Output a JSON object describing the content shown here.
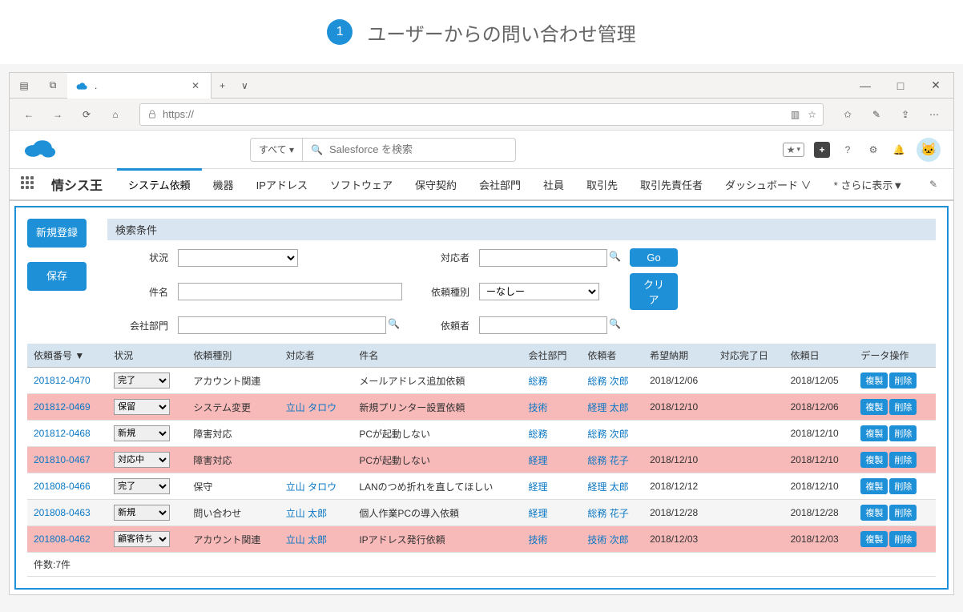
{
  "page_header": {
    "num": "1",
    "title": "ユーザーからの問い合わせ管理"
  },
  "browser": {
    "tab_title": ".",
    "url_prefix": "https://",
    "new_tab": "+",
    "minimize": "—",
    "maximize": "□",
    "close": "✕"
  },
  "sf_header": {
    "search_scope": "すべて ▾",
    "search_placeholder": "Salesforce を検索"
  },
  "nav": {
    "app_name": "情シス王",
    "tabs": [
      "システム依頼",
      "機器",
      "IPアドレス",
      "ソフトウェア",
      "保守契約",
      "会社部門",
      "社員",
      "取引先",
      "取引先責任者",
      "ダッシュボード ∨"
    ],
    "more": "* さらに表示▼"
  },
  "side": {
    "new": "新規登録",
    "save": "保存"
  },
  "filter": {
    "title": "検索条件",
    "labels": {
      "status": "状況",
      "subject": "件名",
      "dept": "会社部門",
      "assignee": "対応者",
      "kind": "依頼種別",
      "requester": "依頼者"
    },
    "kind_option": "ーなしー",
    "go": "Go",
    "clear": "クリア"
  },
  "table": {
    "headers": [
      "依頼番号 ▼",
      "状況",
      "依頼種別",
      "対応者",
      "件名",
      "会社部門",
      "依頼者",
      "希望納期",
      "対応完了日",
      "依頼日",
      "データ操作"
    ],
    "rows": [
      {
        "id": "201812-0470",
        "status": "完了",
        "kind": "アカウント関連",
        "assignee": "",
        "subject": "メールアドレス追加依頼",
        "dept": "総務",
        "requester": "総務 次郎",
        "due": "2018/12/06",
        "done": "",
        "reqdate": "2018/12/05",
        "hl": false
      },
      {
        "id": "201812-0469",
        "status": "保留",
        "kind": "システム変更",
        "assignee": "立山 タロウ",
        "subject": "新規プリンター設置依頼",
        "dept": "技術",
        "requester": "経理 太郎",
        "due": "2018/12/10",
        "done": "",
        "reqdate": "2018/12/06",
        "hl": true
      },
      {
        "id": "201812-0468",
        "status": "新規",
        "kind": "障害対応",
        "assignee": "",
        "subject": "PCが起動しない",
        "dept": "総務",
        "requester": "総務 次郎",
        "due": "",
        "done": "",
        "reqdate": "2018/12/10",
        "hl": false
      },
      {
        "id": "201810-0467",
        "status": "対応中",
        "kind": "障害対応",
        "assignee": "",
        "subject": "PCが起動しない",
        "dept": "経理",
        "requester": "総務 花子",
        "due": "2018/12/10",
        "done": "",
        "reqdate": "2018/12/10",
        "hl": true
      },
      {
        "id": "201808-0466",
        "status": "完了",
        "kind": "保守",
        "assignee": "立山 タロウ",
        "subject": "LANのつめ折れを直してほしい",
        "dept": "経理",
        "requester": "経理 太郎",
        "due": "2018/12/12",
        "done": "",
        "reqdate": "2018/12/10",
        "hl": false
      },
      {
        "id": "201808-0463",
        "status": "新規",
        "kind": "問い合わせ",
        "assignee": "立山 太郎",
        "subject": "個人作業PCの導入依頼",
        "dept": "経理",
        "requester": "総務 花子",
        "due": "2018/12/28",
        "done": "",
        "reqdate": "2018/12/28",
        "hl": false
      },
      {
        "id": "201808-0462",
        "status": "顧客待ち",
        "kind": "アカウント関連",
        "assignee": "立山 太郎",
        "subject": "IPアドレス発行依頼",
        "dept": "技術",
        "requester": "技術 次郎",
        "due": "2018/12/03",
        "done": "",
        "reqdate": "2018/12/03",
        "hl": true
      }
    ],
    "status_options": [
      "新規",
      "対応中",
      "保留",
      "完了",
      "顧客待ち"
    ],
    "row_btns": {
      "copy": "複製",
      "del": "削除"
    },
    "count": "件数:7件"
  }
}
